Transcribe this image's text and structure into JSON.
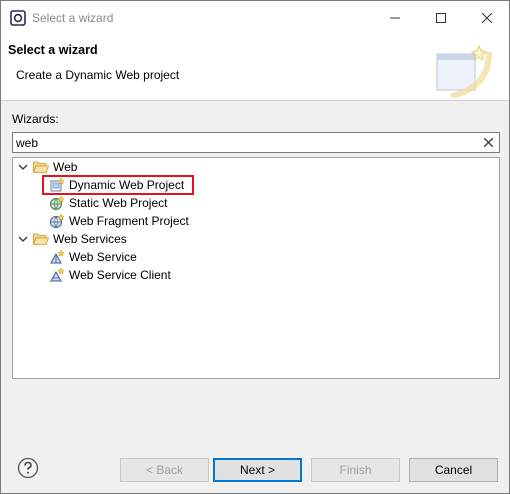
{
  "window": {
    "title": "Select a wizard"
  },
  "header": {
    "title": "Select a wizard",
    "description": "Create a Dynamic Web project"
  },
  "wizards": {
    "label": "Wizards:",
    "filter_value": "web"
  },
  "tree": {
    "web_category": "Web",
    "dynamic_web_project": "Dynamic Web Project",
    "static_web_project": "Static Web Project",
    "web_fragment_project": "Web Fragment Project",
    "web_services_category": "Web Services",
    "web_service": "Web Service",
    "web_service_client": "Web Service Client"
  },
  "footer": {
    "back_label": "< Back",
    "next_label": "Next >",
    "finish_label": "Finish",
    "cancel_label": "Cancel"
  },
  "colors": {
    "highlight": "#e0141e",
    "default_button_border": "#0078d7",
    "folder": "#e8b84a"
  }
}
